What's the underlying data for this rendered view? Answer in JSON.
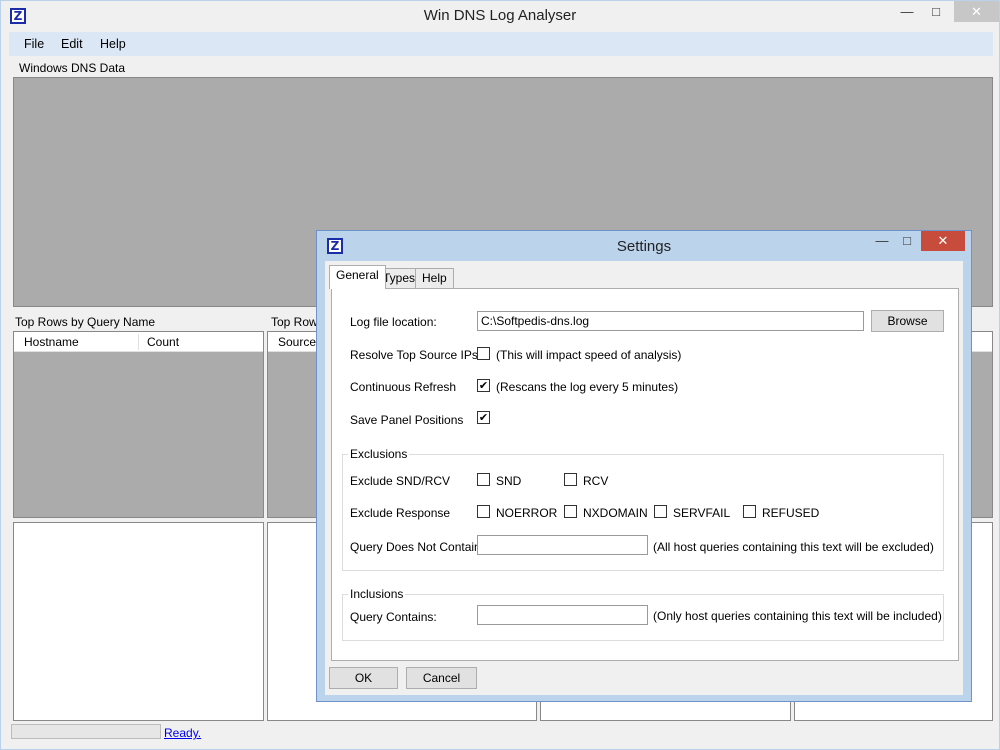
{
  "main": {
    "title": "Win DNS Log Analyser",
    "app_icon": "Z",
    "minimize": "—",
    "maximize": "□",
    "close": "✕",
    "menu": [
      "File",
      "Edit",
      "Help"
    ],
    "dns_panel_label": "Windows DNS Data",
    "top_rows_label_1": "Top Rows by Query Name",
    "top_rows_label_2": "Top Rows",
    "columns_1": [
      "Hostname",
      "Count"
    ],
    "columns_2": [
      "Source I"
    ],
    "status": "Ready."
  },
  "settings": {
    "title": "Settings",
    "app_icon": "Z",
    "minimize": "—",
    "maximize": "□",
    "close": "✕",
    "tabs": [
      "General",
      "Types",
      "Help"
    ],
    "log_file_label": "Log file location:",
    "log_file_value": "C:\\Softpedis-dns.log",
    "browse_label": "Browse",
    "resolve_label": "Resolve Top Source IPs",
    "resolve_note": "(This will impact speed of analysis)",
    "resolve_checked": false,
    "refresh_label": "Continuous Refresh",
    "refresh_note": "(Rescans the log every 5 minutes)",
    "refresh_checked": true,
    "save_panel_label": "Save Panel Positions",
    "save_panel_checked": true,
    "exclusions": {
      "title": "Exclusions",
      "snd_rcv_label": "Exclude SND/RCV",
      "snd": "SND",
      "rcv": "RCV",
      "response_label": "Exclude Response",
      "noerror": "NOERROR",
      "nxdomain": "NXDOMAIN",
      "servfail": "SERVFAIL",
      "refused": "REFUSED",
      "not_contain_label": "Query Does Not Contain:",
      "not_contain_value": "",
      "not_contain_note": "(All host queries containing this text will be excluded)"
    },
    "inclusions": {
      "title": "Inclusions",
      "contains_label": "Query Contains:",
      "contains_value": "",
      "contains_note": "(Only host queries containing this text will be included)"
    },
    "ok_label": "OK",
    "cancel_label": "Cancel",
    "check_mark": "✔"
  }
}
